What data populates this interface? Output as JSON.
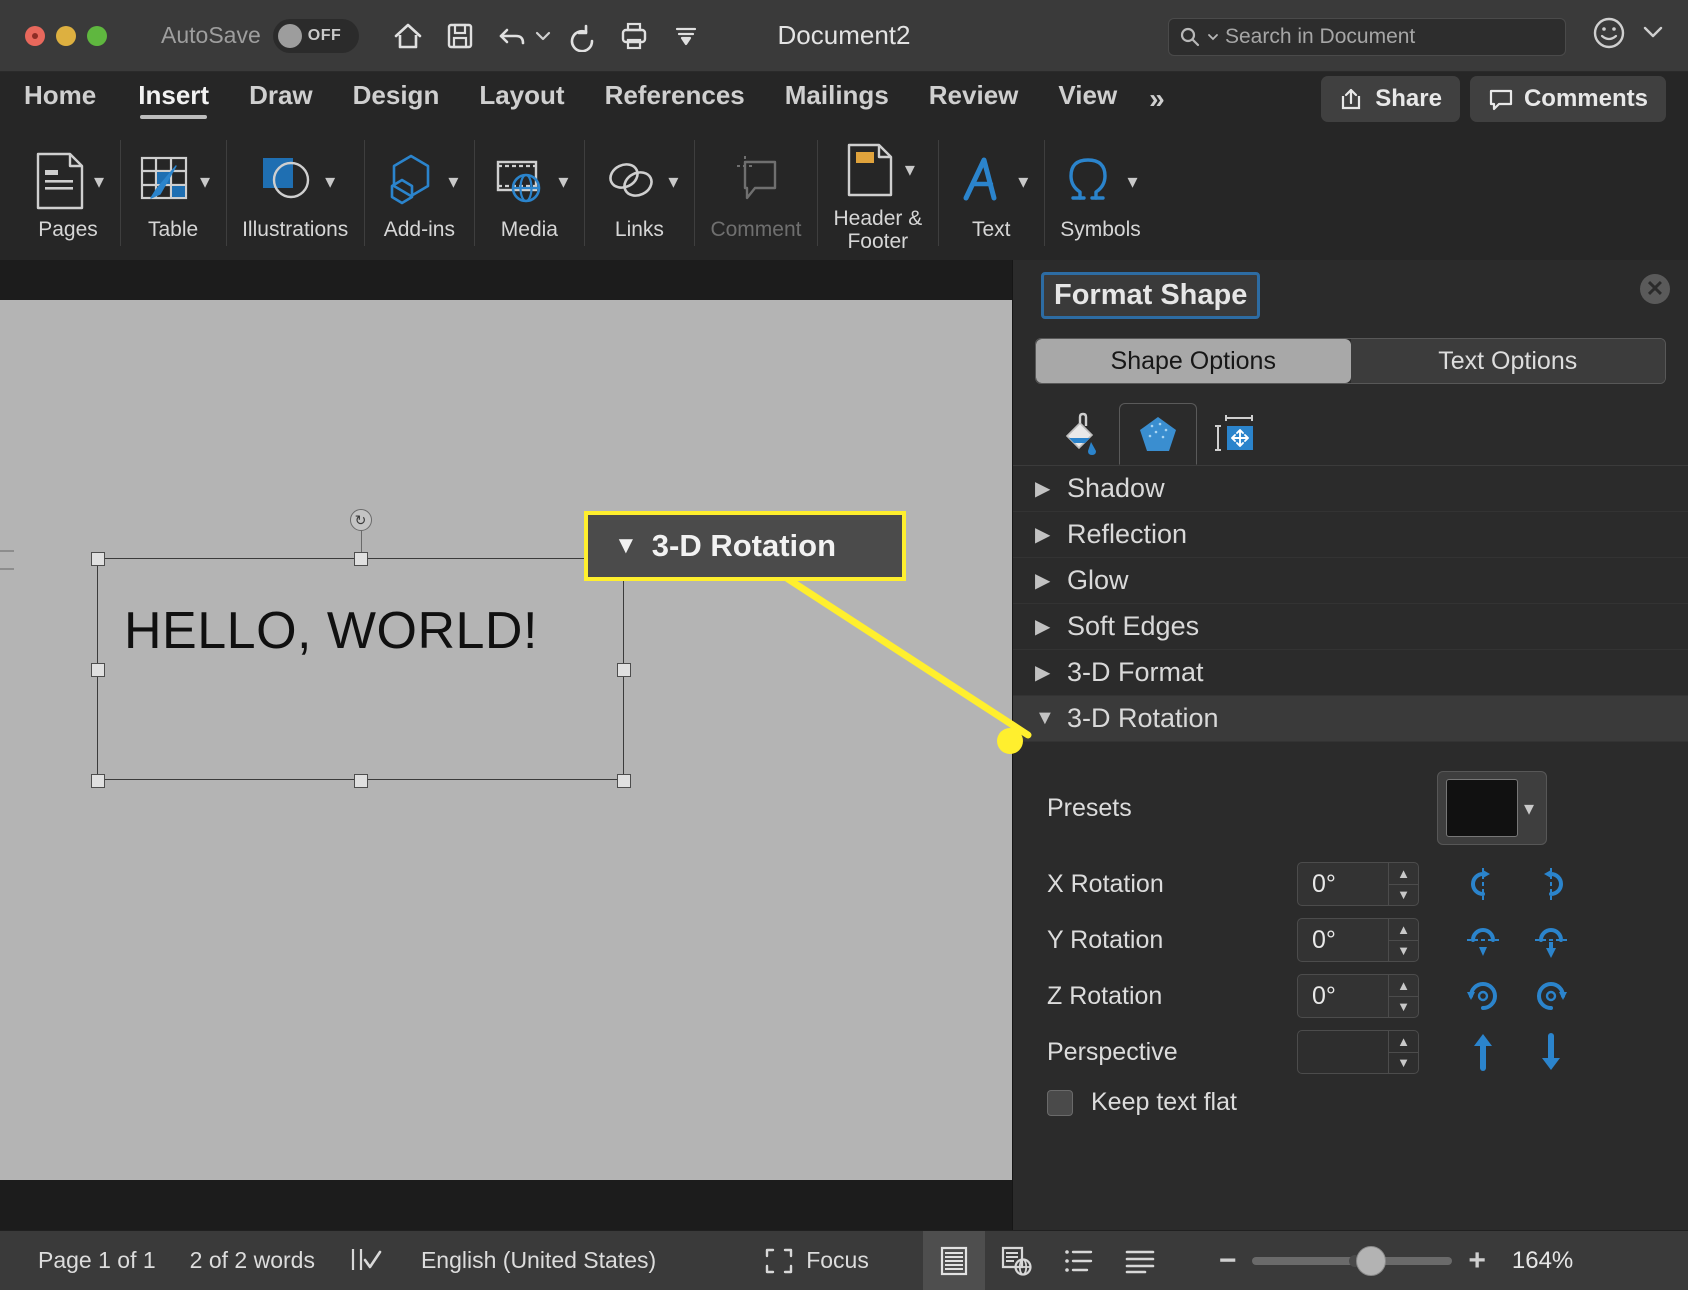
{
  "window": {
    "title": "Document2",
    "autosave_label": "AutoSave",
    "autosave_state": "OFF",
    "traffic_lights": [
      "close-red",
      "minimize-yellow",
      "maximize-green"
    ],
    "quick_access": [
      {
        "name": "home-icon",
        "label": "Home"
      },
      {
        "name": "save-icon",
        "label": "Save"
      },
      {
        "name": "undo-icon",
        "label": "Undo"
      },
      {
        "name": "undo-dropdown-caret",
        "label": "Undo options"
      },
      {
        "name": "redo-icon",
        "label": "Redo"
      },
      {
        "name": "print-icon",
        "label": "Print"
      },
      {
        "name": "customize-toolbar-icon",
        "label": "Customize Quick Access Toolbar"
      }
    ],
    "search_placeholder": "Search in Document",
    "search_value": "",
    "smiley_label": "Send a Smile",
    "titlebar_caret_label": "More"
  },
  "ribbon": {
    "tabs": [
      {
        "label": "Home",
        "active": false
      },
      {
        "label": "Insert",
        "active": true
      },
      {
        "label": "Draw",
        "active": false
      },
      {
        "label": "Design",
        "active": false
      },
      {
        "label": "Layout",
        "active": false
      },
      {
        "label": "References",
        "active": false
      },
      {
        "label": "Mailings",
        "active": false
      },
      {
        "label": "Review",
        "active": false
      },
      {
        "label": "View",
        "active": false
      }
    ],
    "overflow_label": "»",
    "share_label": "Share",
    "comments_label": "Comments",
    "groups": [
      {
        "label": "Pages",
        "icon": "page-icon",
        "has_caret": true,
        "disabled": false
      },
      {
        "label": "Table",
        "icon": "table-icon",
        "has_caret": true,
        "disabled": false
      },
      {
        "label": "Illustrations",
        "icon": "illustrations-icon",
        "has_caret": true,
        "disabled": false
      },
      {
        "label": "Add-ins",
        "icon": "addins-icon",
        "has_caret": true,
        "disabled": false
      },
      {
        "label": "Media",
        "icon": "media-icon",
        "has_caret": true,
        "disabled": false
      },
      {
        "label": "Links",
        "icon": "links-icon",
        "has_caret": true,
        "disabled": false
      },
      {
        "label": "Comment",
        "icon": "comment-icon",
        "has_caret": false,
        "disabled": true
      },
      {
        "label": "Header &\nFooter",
        "icon": "header-footer-icon",
        "has_caret": true,
        "disabled": false
      },
      {
        "label": "Text",
        "icon": "text-icon",
        "has_caret": true,
        "disabled": false
      },
      {
        "label": "Symbols",
        "icon": "symbols-icon",
        "has_caret": true,
        "disabled": false
      }
    ]
  },
  "document": {
    "shape_text": "HELLO, WORLD!",
    "rotate_handle_label": "Rotate shape"
  },
  "callout": {
    "label": "3-D Rotation",
    "triangle": "▼",
    "accent_color": "#ffef2e"
  },
  "panel": {
    "title": "Format Shape",
    "close_label": "Close",
    "segments": [
      {
        "label": "Shape Options",
        "active": true
      },
      {
        "label": "Text Options",
        "active": false
      }
    ],
    "icon_tabs": [
      {
        "name": "fill-line-icon",
        "label": "Fill & Line",
        "active": false
      },
      {
        "name": "effects-pentagon-icon",
        "label": "Effects",
        "active": true
      },
      {
        "name": "size-properties-icon",
        "label": "Size & Properties",
        "active": false
      }
    ],
    "sections": [
      {
        "label": "Shadow",
        "expanded": false
      },
      {
        "label": "Reflection",
        "expanded": false
      },
      {
        "label": "Glow",
        "expanded": false
      },
      {
        "label": "Soft Edges",
        "expanded": false
      },
      {
        "label": "3-D Format",
        "expanded": false
      },
      {
        "label": "3-D Rotation",
        "expanded": true
      }
    ],
    "rotation": {
      "presets_label": "Presets",
      "presets_caret": "▾",
      "fields": [
        {
          "label": "X Rotation",
          "value": "0°",
          "enabled": true,
          "buttons": [
            "x-rotate-left-icon",
            "x-rotate-right-icon"
          ]
        },
        {
          "label": "Y Rotation",
          "value": "0°",
          "enabled": true,
          "buttons": [
            "y-rotate-up-icon",
            "y-rotate-down-icon"
          ]
        },
        {
          "label": "Z Rotation",
          "value": "0°",
          "enabled": true,
          "buttons": [
            "z-rotate-ccw-icon",
            "z-rotate-cw-icon"
          ]
        },
        {
          "label": "Perspective",
          "value": "",
          "enabled": false,
          "buttons": [
            "perspective-narrow-icon",
            "perspective-widen-icon"
          ]
        }
      ],
      "keep_text_flat_label": "Keep text flat",
      "keep_text_flat_checked": false
    }
  },
  "statusbar": {
    "page_info": "Page 1 of 1",
    "word_count": "2 of 2 words",
    "proofing_icon": "proofing-icon",
    "language": "English (United States)",
    "focus_label": "Focus",
    "view_modes": [
      {
        "name": "print-layout-icon",
        "active": true
      },
      {
        "name": "web-layout-icon",
        "active": false
      },
      {
        "name": "outline-icon",
        "active": false
      },
      {
        "name": "draft-icon",
        "active": false
      }
    ],
    "zoom_out_label": "−",
    "zoom_in_label": "+",
    "zoom_level": "164%",
    "zoom_slider_percent": 52
  }
}
